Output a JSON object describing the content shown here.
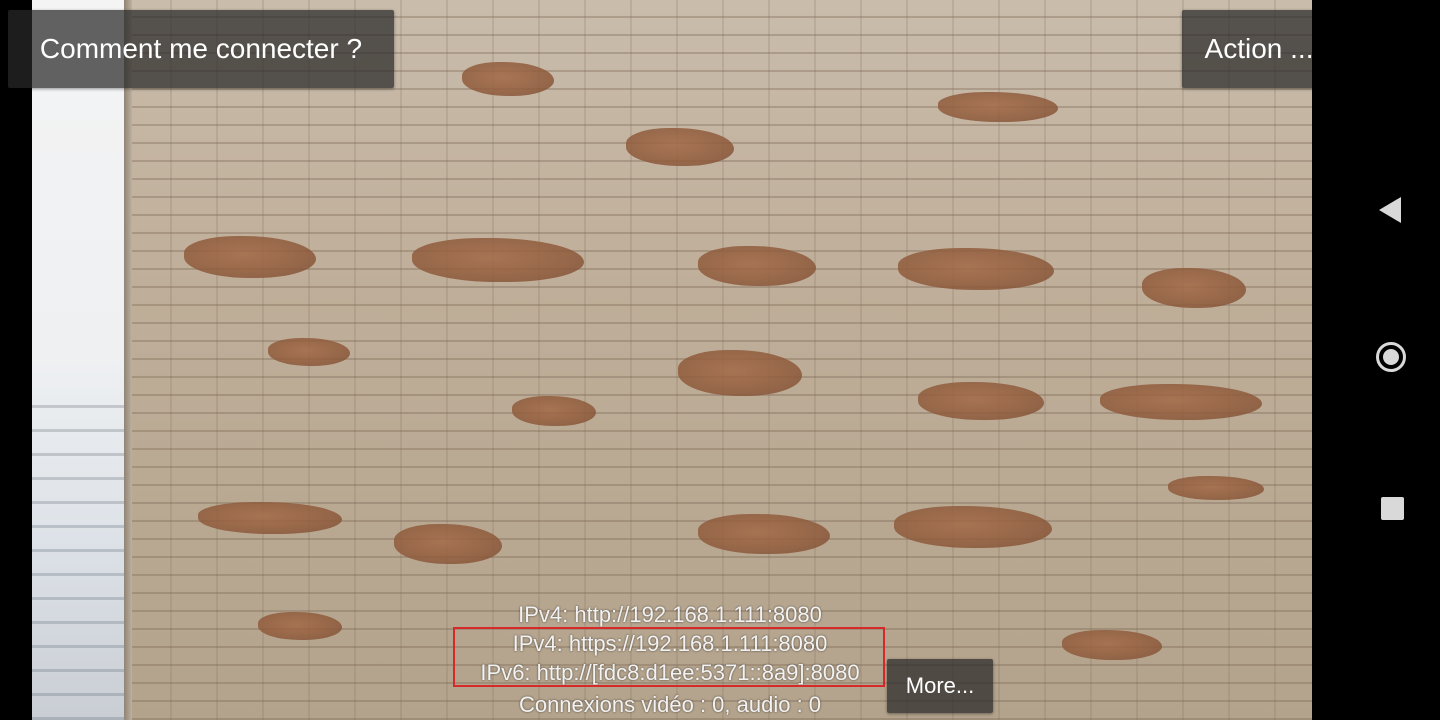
{
  "top_bar": {
    "howto_label": "Comment me connecter ?",
    "action_label": "Action ..."
  },
  "server_info": {
    "ipv4_http": "IPv4: http://192.168.1.111:8080",
    "ipv4_https": "IPv4: https://192.168.1.111:8080",
    "ipv6_http": "IPv6: http://[fdc8:d1ee:5371::8a9]:8080",
    "connections": "Connexions vidéo : 0, audio : 0",
    "highlight_color": "#d62a2a"
  },
  "more_button": {
    "label": "More..."
  },
  "nav_bar": {
    "back_icon": "back-triangle-icon",
    "home_icon": "home-circle-icon",
    "recents_icon": "recents-square-icon"
  }
}
